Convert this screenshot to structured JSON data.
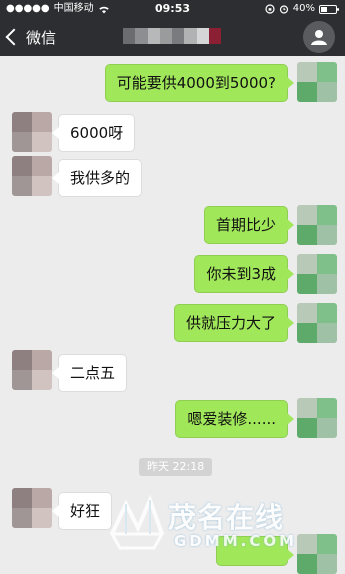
{
  "status_bar": {
    "carrier": "中国移动",
    "time": "09:53",
    "battery": "40%"
  },
  "nav": {
    "back_label": "微信"
  },
  "messages": [
    {
      "side": "out",
      "text": "可能要供4000到5000?"
    },
    {
      "side": "in",
      "text": "6000呀"
    },
    {
      "side": "in",
      "text": "我供多的"
    },
    {
      "side": "out",
      "text": "首期比少"
    },
    {
      "side": "out",
      "text": "你未到3成"
    },
    {
      "side": "out",
      "text": "供就压力大了"
    },
    {
      "side": "in",
      "text": "二点五"
    },
    {
      "side": "out",
      "text": "嗯爱装修......"
    },
    {
      "side": "in",
      "text": "好狂"
    }
  ],
  "timestamp": "昨天 22:18",
  "watermark": {
    "cn": "茂名在线",
    "en": "GDMM.COM"
  },
  "colors": {
    "topbar": "#2d2e31",
    "chat_bg": "#ececec",
    "bubble_out": "#a0e75a",
    "bubble_in": "#ffffff"
  },
  "icons": {
    "back": "chevron-left-icon",
    "profile": "person-icon",
    "wifi": "wifi-icon",
    "battery": "battery-icon"
  }
}
